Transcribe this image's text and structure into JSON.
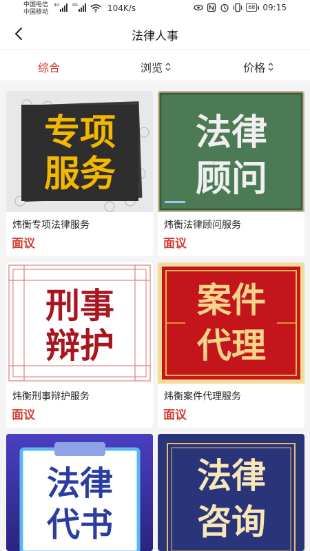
{
  "status_bar": {
    "carrier1": "中国电信",
    "carrier2": "中国移动",
    "net1": "4G",
    "net2": "4G",
    "speed": "104K/s",
    "battery": "68",
    "time": "09:15"
  },
  "header": {
    "title": "法律人事"
  },
  "sort_tabs": [
    {
      "label": "综合",
      "active": true
    },
    {
      "label": "浏览",
      "active": false
    },
    {
      "label": "价格",
      "active": false
    }
  ],
  "colors": {
    "accent": "#d23b32",
    "background": "#f4f4f4"
  },
  "products": [
    {
      "name": "炜衡专项法律服务",
      "price": "面议",
      "image_line1": "专项",
      "image_line2": "服务"
    },
    {
      "name": "炜衡法律顾问服务",
      "price": "面议",
      "image_line1": "法律",
      "image_line2": "顾问"
    },
    {
      "name": "炜衡刑事辩护服务",
      "price": "面议",
      "image_line1": "刑事",
      "image_line2": "辩护"
    },
    {
      "name": "炜衡案件代理服务",
      "price": "面议",
      "image_line1": "案件",
      "image_line2": "代理"
    },
    {
      "name": "",
      "price": "",
      "image_line1": "法律",
      "image_line2": "代书"
    },
    {
      "name": "",
      "price": "",
      "image_line1": "法律",
      "image_line2": "咨询"
    }
  ]
}
